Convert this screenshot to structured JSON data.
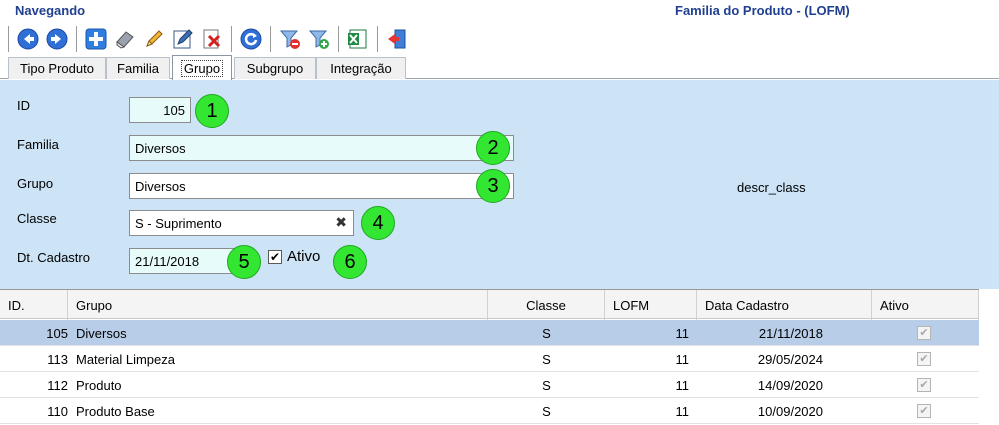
{
  "header": {
    "nav_title": "Navegando",
    "form_title": "Familia do Produto - (LOFM)"
  },
  "toolbar": {
    "buttons": [
      {
        "name": "previous-icon"
      },
      {
        "name": "next-icon"
      },
      {
        "name": "add-icon"
      },
      {
        "name": "eraser-icon"
      },
      {
        "name": "edit-icon"
      },
      {
        "name": "confirm-edit-icon"
      },
      {
        "name": "delete-icon"
      },
      {
        "name": "refresh-icon"
      },
      {
        "name": "filter-remove-icon"
      },
      {
        "name": "filter-add-icon"
      },
      {
        "name": "excel-icon"
      },
      {
        "name": "exit-icon"
      }
    ]
  },
  "tabs": [
    {
      "label": "Tipo Produto"
    },
    {
      "label": "Familia"
    },
    {
      "label": "Grupo",
      "active": true
    },
    {
      "label": "Subgrupo"
    },
    {
      "label": "Integração"
    }
  ],
  "form": {
    "id_label": "ID",
    "id_value": "105",
    "familia_label": "Familia",
    "familia_value": "Diversos",
    "grupo_label": "Grupo",
    "grupo_value": "Diversos",
    "classe_label": "Classe",
    "classe_value": "S - Suprimento",
    "classe_clear": "✖",
    "descr_class": "descr_class",
    "dt_cadastro_label": "Dt. Cadastro",
    "dt_cadastro_value": "21/11/2018",
    "ativo_label": "Ativo",
    "ativo_checked": true
  },
  "badges": [
    "1",
    "2",
    "3",
    "4",
    "5",
    "6"
  ],
  "grid": {
    "columns": [
      "ID.",
      "Grupo",
      "Classe",
      "LOFM",
      "Data Cadastro",
      "Ativo"
    ],
    "rows": [
      {
        "id": "105",
        "grupo": "Diversos",
        "classe": "S",
        "lofm": "11",
        "data": "21/11/2018",
        "ativo": true,
        "selected": true
      },
      {
        "id": "113",
        "grupo": "Material Limpeza",
        "classe": "S",
        "lofm": "11",
        "data": "29/05/2024",
        "ativo": true
      },
      {
        "id": "112",
        "grupo": "Produto",
        "classe": "S",
        "lofm": "11",
        "data": "14/09/2020",
        "ativo": true
      },
      {
        "id": "110",
        "grupo": "Produto Base",
        "classe": "S",
        "lofm": "11",
        "data": "10/09/2020",
        "ativo": true
      }
    ]
  },
  "colors": {
    "title": "#1f3f8f",
    "form_bg": "#cde4f7",
    "selected_row": "#b8cde8",
    "badge": "#33e632"
  }
}
